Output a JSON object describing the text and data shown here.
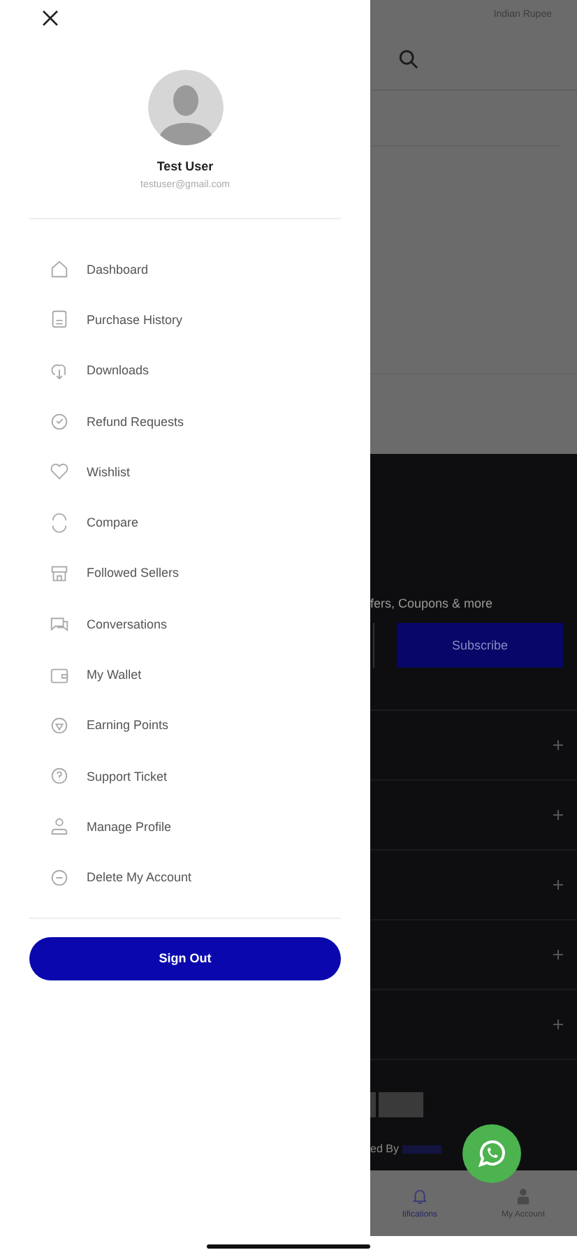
{
  "drawer": {
    "user": {
      "name": "Test User",
      "email": "testuser@gmail.com"
    },
    "menu": [
      {
        "label": "Dashboard"
      },
      {
        "label": "Purchase History"
      },
      {
        "label": "Downloads"
      },
      {
        "label": "Refund Requests"
      },
      {
        "label": "Wishlist"
      },
      {
        "label": "Compare"
      },
      {
        "label": "Followed Sellers"
      },
      {
        "label": "Conversations"
      },
      {
        "label": "My Wallet"
      },
      {
        "label": "Earning Points"
      },
      {
        "label": "Support Ticket"
      },
      {
        "label": "Manage Profile"
      },
      {
        "label": "Delete My Account"
      }
    ],
    "sign_out": "Sign Out"
  },
  "background": {
    "currency": "Indian Rupee",
    "newsletter_text": "fers, Coupons & more",
    "subscribe": "Subscribe",
    "powered_by": "ed By",
    "bottom_nav": [
      {
        "label": "tifications"
      },
      {
        "label": "My Account"
      }
    ]
  }
}
